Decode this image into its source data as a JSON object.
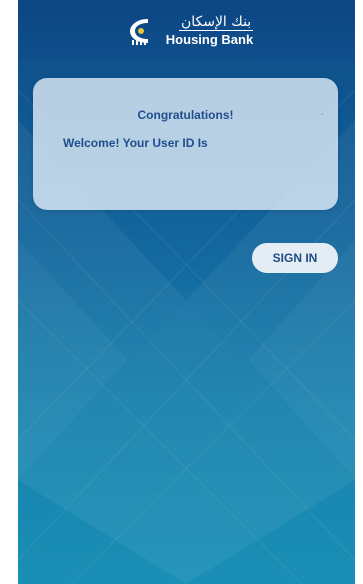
{
  "brand": {
    "name_arabic": "بنك الإسكان",
    "name_english": "Housing Bank"
  },
  "dialog": {
    "title": "Congratulations!",
    "message": "Welcome! Your User ID Is",
    "close_glyph": "-"
  },
  "actions": {
    "sign_in_label": "SIGN IN"
  },
  "colors": {
    "header": "#0c4683",
    "background_top": "#0f4d86",
    "background_bottom": "#1a8fb6",
    "card": "#e2eef8",
    "text_accent": "#1f4e8d"
  }
}
